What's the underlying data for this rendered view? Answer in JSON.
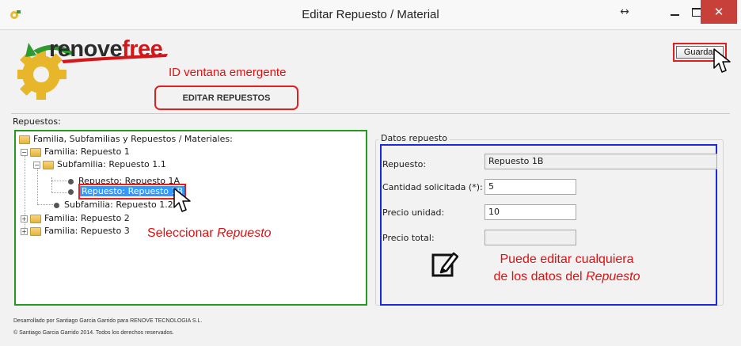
{
  "window": {
    "title": "Editar Repuesto / Material",
    "resize_glyph": "↔",
    "close_glyph": "✕"
  },
  "logo": {
    "text_dark": "renove",
    "text_red": "free"
  },
  "annotations": {
    "id_label": "ID  ventana emergente",
    "window_id": "EDITAR REPUESTOS",
    "select_prefix": "Seleccionar ",
    "select_em": "Repuesto",
    "edit_line1": "Puede editar cualquiera",
    "edit_line2_prefix": "de los datos del ",
    "edit_line2_em": "Repuesto"
  },
  "toolbar": {
    "save_label": "Guardar"
  },
  "repuestos_label": "Repuestos:",
  "tree": {
    "root": "Familia, Subfamilias y Repuestos / Materiales:",
    "fam1": "Familia: Repuesto 1",
    "sub11": "Subfamilia: Repuesto 1.1",
    "rep1a": "Repuesto: Repuesto 1A",
    "rep1b": "Repuesto: Repuesto 1B",
    "sub12": "Subfamilia: Repuesto 1.2",
    "fam2": "Familia: Repuesto 2",
    "fam3": "Familia: Repuesto 3"
  },
  "datos": {
    "legend": "Datos repuesto",
    "repuesto_label": "Repuesto:",
    "repuesto_value": "Repuesto 1B",
    "cantidad_label": "Cantidad solicitada (*):",
    "cantidad_value": "5",
    "precio_unidad_label": "Precio unidad:",
    "precio_unidad_value": "10",
    "precio_total_label": "Precio total:",
    "precio_total_value": ""
  },
  "footer": {
    "line1": "Desarrollado por Santiago Garcia Garrido para RENOVE TECNOLOGIA S.L.",
    "line2": "© Santiago Garcia Garrido 2014. Todos los derechos reservados."
  },
  "colors": {
    "annotation_red": "#e01010",
    "tree_border_green": "#239b23",
    "datos_border_blue": "#1c28e0",
    "selection_blue": "#3399ff",
    "close_button": "#c8403a"
  }
}
